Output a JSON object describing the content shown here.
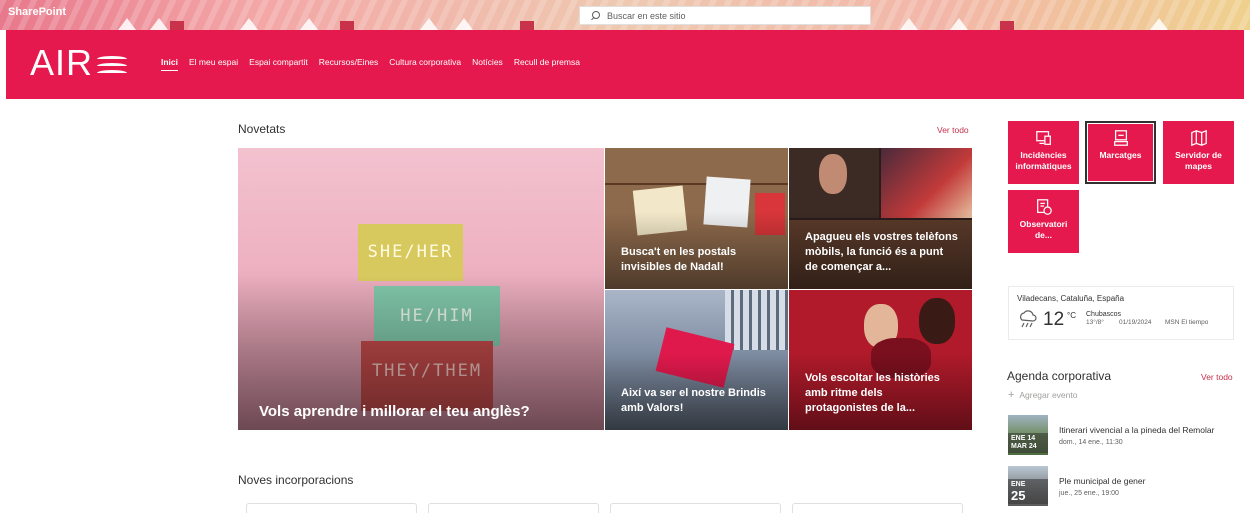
{
  "suite": {
    "app_name": "SharePoint",
    "search_placeholder": "Buscar en este sitio"
  },
  "header": {
    "logo_text": "AIR",
    "nav": [
      "Inici",
      "El meu espai",
      "Espai compartit",
      "Recursos/Eines",
      "Cultura corporativa",
      "Notícies",
      "Recull de premsa"
    ],
    "active_nav": "Inici",
    "brand_color": "#e5194d"
  },
  "novetats": {
    "title": "Novetats",
    "see_all": "Ver todo",
    "main": {
      "caption": "Vols aprendre i millorar el teu anglès?",
      "blocks": [
        "SHE/HER",
        "HE/HIM",
        "THEY/THEM"
      ]
    },
    "tiles": [
      {
        "caption": "Busca't en les postals invisibles de Nadal!"
      },
      {
        "caption": "Apagueu els vostres telèfons mòbils, la funció és a punt de començar a..."
      },
      {
        "caption": "Així va ser el nostre Brindis amb Valors!"
      },
      {
        "caption": "Vols escoltar les històries amb ritme dels protagonistes de la..."
      }
    ]
  },
  "noves_incorporacions": {
    "title": "Noves incorporacions"
  },
  "quick_links": [
    {
      "label": "Incidències informàtiques",
      "icon": "devices-icon"
    },
    {
      "label": "Marcatges",
      "icon": "computer-icon",
      "selected": true
    },
    {
      "label": "Servidor de mapes",
      "icon": "map-icon"
    },
    {
      "label": "Observatori de...",
      "icon": "report-icon"
    }
  ],
  "weather": {
    "location": "Viladecans, Cataluña, España",
    "temperature": "12",
    "unit": "°C",
    "condition": "Chubascos",
    "range": "13°/8°",
    "date": "01/19/2024",
    "source": "MSN El tiempo",
    "icon": "rain-cloud-icon"
  },
  "agenda": {
    "title": "Agenda corporativa",
    "see_all": "Ver todo",
    "add_event": "Agregar evento",
    "events": [
      {
        "dates_line1": "ENE 14",
        "dates_line2": "MAR 24",
        "title": "Itinerari vivencial a la pineda del Remolar",
        "when": "dom., 14 ene., 11:30"
      },
      {
        "month": "ENE",
        "day": "25",
        "title": "Ple municipal de gener",
        "when": "jue., 25 ene., 19:00"
      }
    ]
  }
}
